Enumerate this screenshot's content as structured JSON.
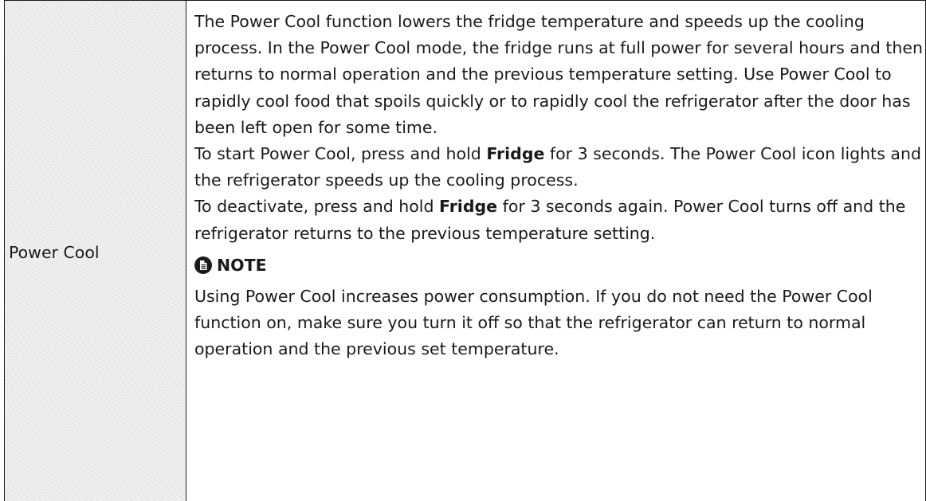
{
  "row": {
    "label": "Power Cool",
    "paragraph_1": "The Power Cool function lowers the fridge temperature and speeds up the cooling process. In the Power Cool mode, the fridge runs at full power for several hours and then returns to normal operation and the previous temperature setting. Use Power Cool to rapidly cool food that spoils quickly or to rapidly cool the refrigerator after the door has been left open for some time.",
    "paragraph_2": {
      "before": "To start Power Cool, press and hold ",
      "button": "Fridge",
      "after": " for 3 seconds. The Power Cool icon lights and the refrigerator speeds up the cooling process."
    },
    "paragraph_3": {
      "before": "To deactivate, press and hold ",
      "button": "Fridge",
      "after": " for 3 seconds again. Power Cool turns off and the refrigerator returns to the previous temperature setting."
    },
    "note": {
      "icon": "note-document-icon",
      "heading": "NOTE",
      "body": "Using Power Cool increases power consumption. If you do not need the Power Cool function on, make sure you turn it off so that the refrigerator can return to normal operation and the previous set temperature."
    }
  }
}
